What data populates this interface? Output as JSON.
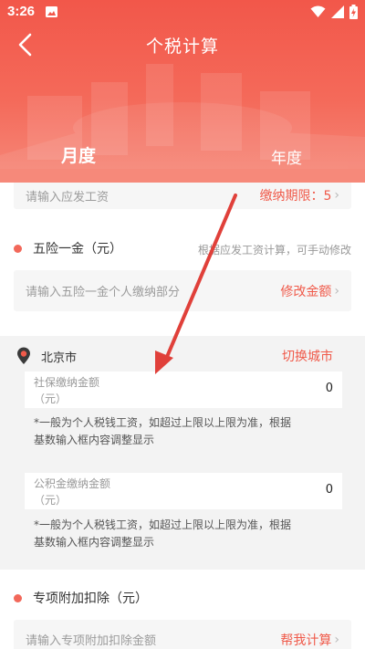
{
  "status_bar": {
    "time": "3:26"
  },
  "header": {
    "title": "个税计算"
  },
  "tabs": [
    {
      "label": "月度",
      "active": true
    },
    {
      "label": "年度",
      "active": false
    }
  ],
  "salary_row": {
    "placeholder": "请输入应发工资",
    "action": "缴纳期限：5"
  },
  "insurance": {
    "label": "五险一金（元）",
    "hint": "根据应发工资计算，可手动修改",
    "placeholder": "请输入五险一金个人缴纳部分",
    "action": "修改金额"
  },
  "city": {
    "name": "北京市",
    "switch_label": "切换城市"
  },
  "social_security": {
    "label_line1": "社保缴纳金额",
    "label_line2": "（元）",
    "value": "0",
    "note_line1": "*一般为个人税钱工资，如超过上限以上限为准，根据",
    "note_line2": "基数输入框内容调整显示"
  },
  "housing_fund": {
    "label_line1": "公积金缴纳金额",
    "label_line2": "（元）",
    "value": "0",
    "note_line1": "*一般为个人税钱工资，如超过上限以上限为准，根据",
    "note_line2": "基数输入框内容调整显示"
  },
  "special_deduction": {
    "label": "专项附加扣除（元）",
    "placeholder": "请输入专项附加扣除金额",
    "action": "帮我计算"
  },
  "colors": {
    "accent": "#f05a4a",
    "header": "#f2574a",
    "dot": "#f2685a"
  }
}
